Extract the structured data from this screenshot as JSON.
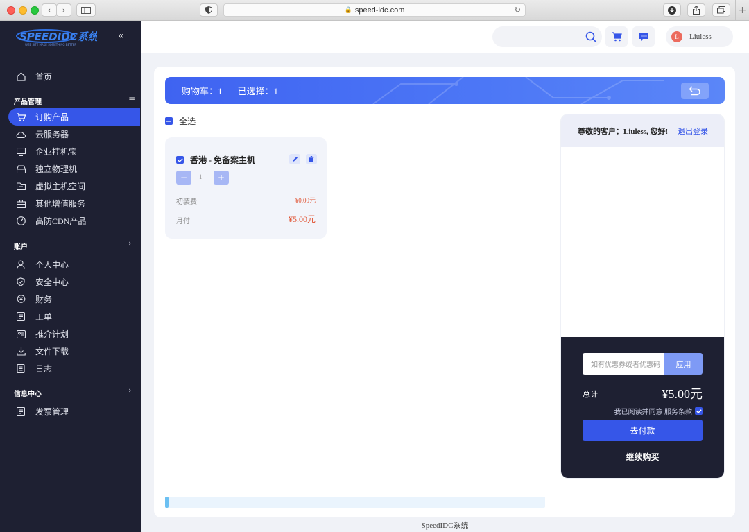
{
  "browser": {
    "url": "speed-idc.com"
  },
  "logo": {
    "text": "SPEEDIDC系统",
    "subtitle": "WEB SITE MAKE SOMETHING BETTER"
  },
  "sidebar": {
    "home": "首页",
    "section_products": "产品管理",
    "product_items": [
      {
        "label": "订购产品",
        "icon": "cart-icon",
        "active": true
      },
      {
        "label": "云服务器",
        "icon": "cloud-icon"
      },
      {
        "label": "企业挂机宝",
        "icon": "monitor-icon"
      },
      {
        "label": "独立物理机",
        "icon": "server-icon"
      },
      {
        "label": "虚拟主机空间",
        "icon": "folder-icon"
      },
      {
        "label": "其他增值服务",
        "icon": "briefcase-icon"
      },
      {
        "label": "高防CDN产品",
        "icon": "gauge-icon"
      }
    ],
    "section_account": "账户",
    "account_items": [
      {
        "label": "个人中心",
        "icon": "user-icon"
      },
      {
        "label": "安全中心",
        "icon": "shield-icon"
      },
      {
        "label": "财务",
        "icon": "finance-icon"
      },
      {
        "label": "工单",
        "icon": "ticket-icon"
      },
      {
        "label": "推介计划",
        "icon": "referral-icon"
      },
      {
        "label": "文件下载",
        "icon": "download-icon"
      },
      {
        "label": "日志",
        "icon": "log-icon"
      }
    ],
    "section_info": "信息中心",
    "info_items": [
      {
        "label": "发票管理",
        "icon": "invoice-icon"
      }
    ]
  },
  "header": {
    "username": "Liuless",
    "avatar_letter": "L",
    "search_placeholder": ""
  },
  "cart": {
    "count_label": "购物车：1",
    "selected_label": "已选择：1",
    "select_all": "全选",
    "item": {
      "name": "香港 - 免备案主机",
      "quantity": "1",
      "setup_label": "初装费",
      "setup_price": "¥0.00元",
      "cycle_label": "月付",
      "cycle_price": "¥5.00元"
    }
  },
  "summary": {
    "greeting": "尊敬的客户：Liuless, 您好!",
    "logout": "退出登录",
    "coupon_placeholder": "如有优惠券或者优惠码",
    "apply": "应用",
    "total_label": "总计",
    "total_value": "¥5.00元",
    "agree_text": "我已阅读并同意 服务条款",
    "pay_button": "去付款",
    "continue": "继续购买"
  },
  "progress": {
    "fraction": 0.01
  },
  "footer": {
    "text": "SpeedIDC系统"
  },
  "colors": {
    "accent": "#3656e8",
    "sidebar": "#1e2032",
    "price": "#e0502f"
  }
}
